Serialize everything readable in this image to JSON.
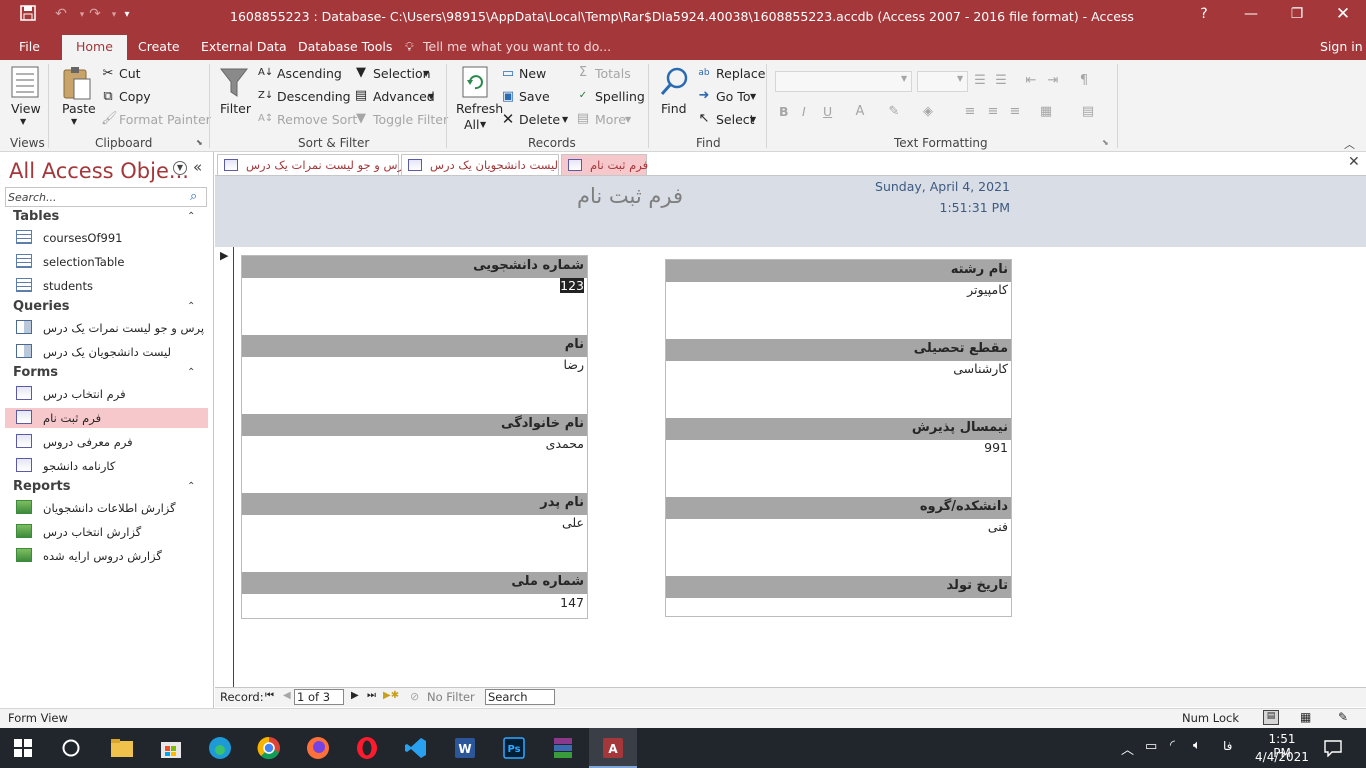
{
  "app": {
    "title": "1608855223 : Database- C:\\Users\\98915\\AppData\\Local\\Temp\\Rar$DIa5924.40038\\1608855223.accdb (Access 2007 - 2016 file format) - Access",
    "help": "?",
    "signin": "Sign in",
    "accent": "#a4373a"
  },
  "tabs": {
    "file": "File",
    "home": "Home",
    "create": "Create",
    "external": "External Data",
    "dbtools": "Database Tools",
    "tellme": "Tell me what you want to do..."
  },
  "ribbon": {
    "views": {
      "view": "View",
      "group": "Views"
    },
    "clipboard": {
      "paste": "Paste",
      "cut": "Cut",
      "copy": "Copy",
      "painter": "Format Painter",
      "group": "Clipboard"
    },
    "sortfilter": {
      "filter": "Filter",
      "ascending": "Ascending",
      "descending": "Descending",
      "remove_sort": "Remove Sort",
      "selection": "Selection",
      "advanced": "Advanced",
      "toggle": "Toggle Filter",
      "group": "Sort & Filter"
    },
    "records": {
      "refresh": "Refresh",
      "all": "All",
      "new": "New",
      "save": "Save",
      "delete": "Delete",
      "totals": "Totals",
      "spelling": "Spelling",
      "more": "More",
      "group": "Records"
    },
    "find": {
      "find": "Find",
      "replace": "Replace",
      "goto": "Go To",
      "select": "Select",
      "group": "Find"
    },
    "text": {
      "bold": "B",
      "italic": "I",
      "underline": "U",
      "group": "Text Formatting"
    }
  },
  "nav": {
    "title": "All Access Obje...",
    "search_placeholder": "Search...",
    "sections": [
      {
        "name": "Tables",
        "items": [
          "coursesOf991",
          "selectionTable",
          "students"
        ]
      },
      {
        "name": "Queries",
        "items": [
          "پرس و جو لیست نمرات یک درس",
          "لیست دانشجویان یک درس"
        ]
      },
      {
        "name": "Forms",
        "items": [
          "فرم انتخاب درس",
          "فرم ثبت نام",
          "فرم معرفی دروس",
          "کارنامه دانشجو"
        ]
      },
      {
        "name": "Reports",
        "items": [
          "گزارش اطلاعات دانشجویان",
          "گزارش انتخاب درس",
          "گزارش دروس ارایه شده"
        ]
      }
    ],
    "selected": "فرم ثبت نام"
  },
  "doctabs": [
    "پرس و جو لیست نمرات یک درس",
    "لیست دانشجویان یک درس",
    "فرم ثبت نام"
  ],
  "form": {
    "title": "فرم ثبت نام",
    "date": "Sunday, April 4, 2021",
    "time": "1:51:31 PM",
    "left": [
      {
        "label": "شماره دانشجویی",
        "value": "123"
      },
      {
        "label": "نام",
        "value": "رضا"
      },
      {
        "label": "نام خانوادگی",
        "value": "محمدی"
      },
      {
        "label": "نام پدر",
        "value": "علی"
      },
      {
        "label": "شماره ملی",
        "value": "147"
      }
    ],
    "right": [
      {
        "label": "نام رشته",
        "value": "کامپیوتر"
      },
      {
        "label": "مقطع تحصیلی",
        "value": "کارشناسی"
      },
      {
        "label": "نیمسال پذیرش",
        "value": "991"
      },
      {
        "label": "دانشکده/گروه",
        "value": "فنی"
      },
      {
        "label": "تاریخ تولد",
        "value": ""
      }
    ]
  },
  "recnav": {
    "record_label": "Record:",
    "position": "1 of 3",
    "nofilter": "No Filter",
    "search": "Search"
  },
  "status": {
    "view": "Form View",
    "numlock": "Num Lock"
  },
  "taskbar": {
    "lang": "فا",
    "time": "1:51 PM",
    "date": "4/4/2021"
  }
}
